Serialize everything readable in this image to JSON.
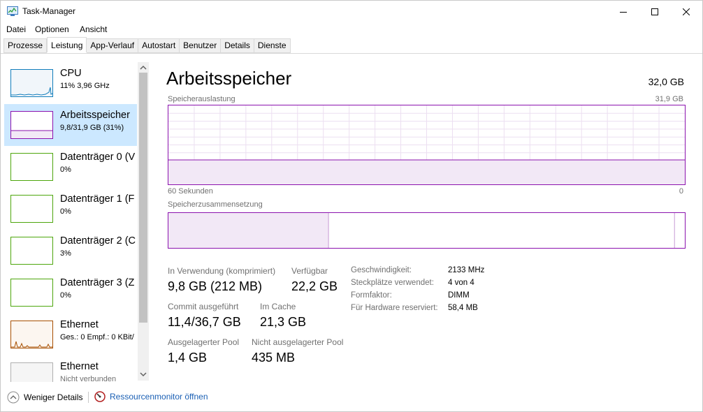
{
  "window": {
    "title": "Task-Manager"
  },
  "menu": [
    "Datei",
    "Optionen",
    "Ansicht"
  ],
  "tabs": [
    {
      "label": "Prozesse",
      "active": false
    },
    {
      "label": "Leistung",
      "active": true
    },
    {
      "label": "App-Verlauf",
      "active": false
    },
    {
      "label": "Autostart",
      "active": false
    },
    {
      "label": "Benutzer",
      "active": false
    },
    {
      "label": "Details",
      "active": false
    },
    {
      "label": "Dienste",
      "active": false
    }
  ],
  "sidebar": {
    "items": [
      {
        "name": "CPU",
        "sub": "11% 3,96 GHz",
        "color": "#117dbb"
      },
      {
        "name": "Arbeitsspeicher",
        "sub": "9,8/31,9 GB (31%)",
        "color": "#8b12ae",
        "selected": true
      },
      {
        "name": "Datenträger 0 (V",
        "sub": "0%",
        "color": "#4da60c"
      },
      {
        "name": "Datenträger 1 (F",
        "sub": "0%",
        "color": "#4da60c"
      },
      {
        "name": "Datenträger 2 (C",
        "sub": "3%",
        "color": "#4da60c"
      },
      {
        "name": "Datenträger 3 (Z",
        "sub": "0%",
        "color": "#4da60c"
      },
      {
        "name": "Ethernet",
        "sub": "Ges.: 0 Empf.: 0 KBit/",
        "color": "#a74f01"
      },
      {
        "name": "Ethernet",
        "sub": "Nicht verbunden",
        "color": "#a0a0a0"
      }
    ]
  },
  "memory": {
    "title": "Arbeitsspeicher",
    "total": "32,0 GB",
    "usage_label": "Speicherauslastung",
    "usage_max": "31,9 GB",
    "usage_fraction": 0.31,
    "time_left": "60 Sekunden",
    "time_right": "0",
    "composition_label": "Speicherzusammensetzung",
    "composition": {
      "in_use_fraction": 0.31,
      "modified_fraction": 0.002,
      "standby_fraction": 0.668
    },
    "stats": {
      "in_use_label": "In Verwendung (komprimiert)",
      "in_use_value": "9,8 GB (212 MB)",
      "available_label": "Verfügbar",
      "available_value": "22,2 GB",
      "commit_label": "Commit ausgeführt",
      "commit_value": "11,4/36,7 GB",
      "cache_label": "Im Cache",
      "cache_value": "21,3 GB",
      "paged_label": "Ausgelagerter Pool",
      "paged_value": "1,4 GB",
      "nonpaged_label": "Nicht ausgelagerter Pool",
      "nonpaged_value": "435 MB"
    },
    "details": [
      {
        "key": "Geschwindigkeit:",
        "value": "2133 MHz"
      },
      {
        "key": "Steckplätze verwendet:",
        "value": "4 von 4"
      },
      {
        "key": "Formfaktor:",
        "value": "DIMM"
      },
      {
        "key": "Für Hardware reserviert:",
        "value": "58,4 MB"
      }
    ]
  },
  "footer": {
    "fewer_details": "Weniger Details",
    "resource_monitor": "Ressourcenmonitor öffnen"
  }
}
